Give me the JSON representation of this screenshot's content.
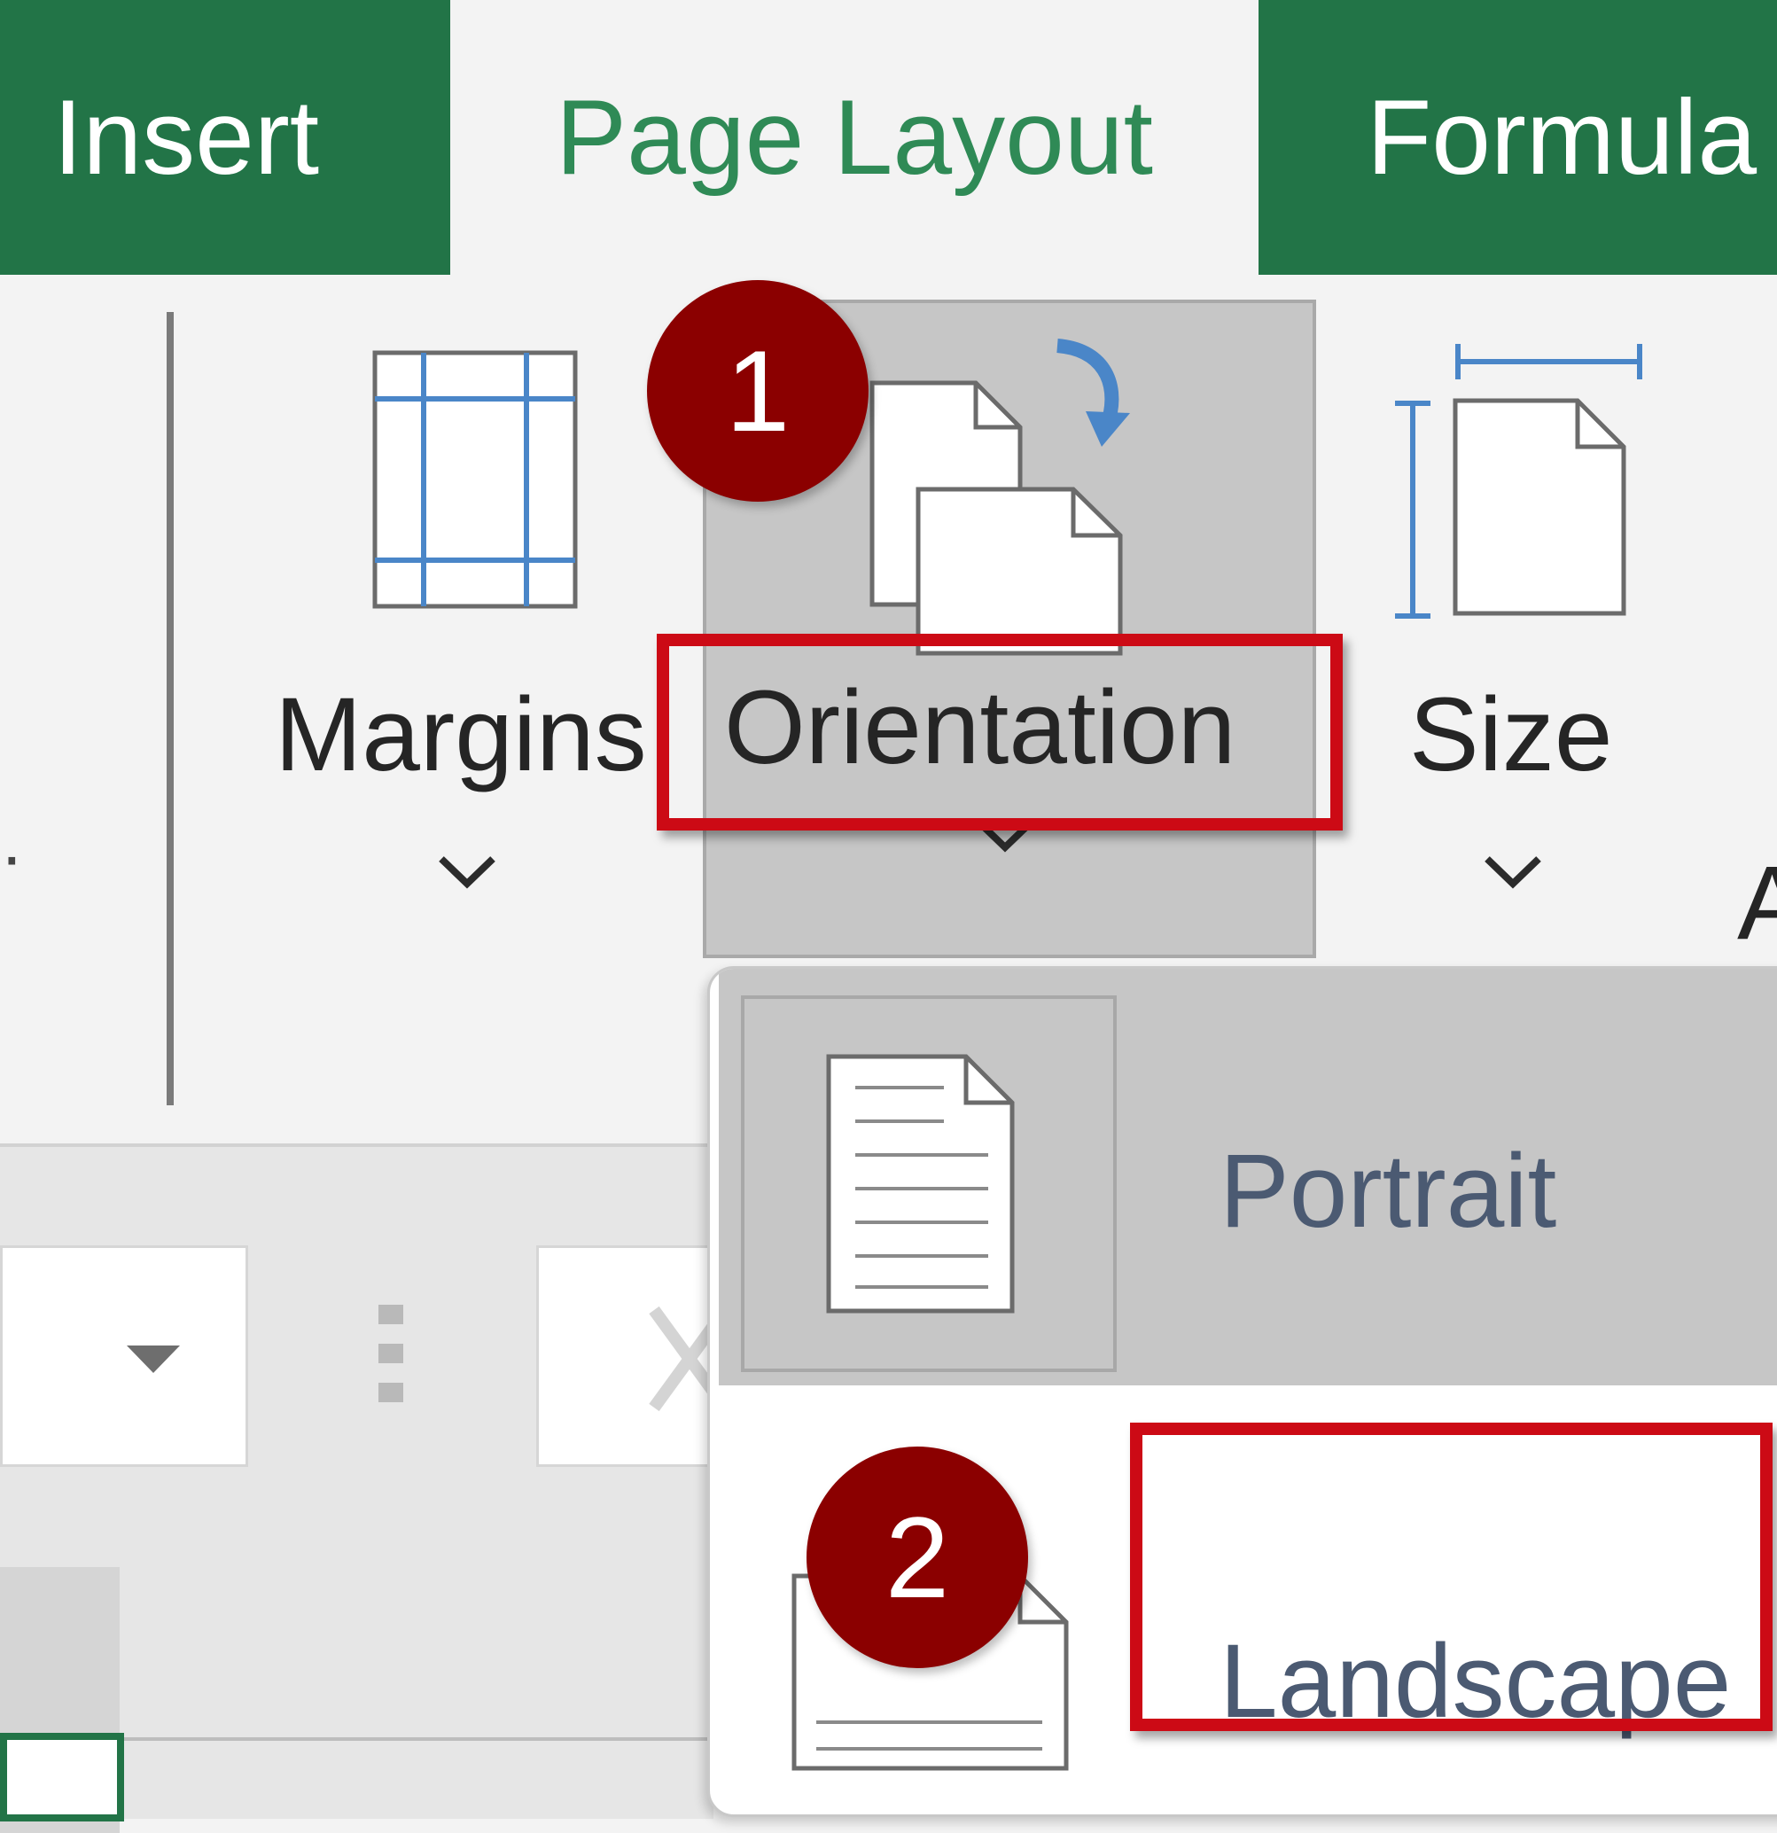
{
  "tabs": [
    {
      "label": "Insert",
      "active": false
    },
    {
      "label": "Page Layout",
      "active": true
    },
    {
      "label": "Formula",
      "active": false
    }
  ],
  "ribbon": {
    "margins_label": "Margins",
    "orientation_label": "Orientation",
    "size_label": "Size",
    "partial_label": "A"
  },
  "orientation_menu": {
    "portrait_label": "Portrait",
    "landscape_label": "Landscape"
  },
  "badges": [
    "1",
    "2"
  ],
  "colors": {
    "tab_green": "#227447",
    "active_tab_text": "#2f8a56",
    "highlight_red": "#cc0a15",
    "badge_red": "#8b0000",
    "icon_blue": "#4a86c8"
  }
}
